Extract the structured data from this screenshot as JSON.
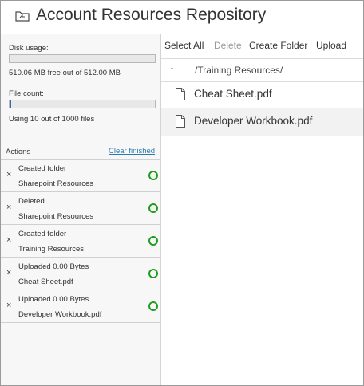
{
  "window": {
    "title": "Account Resources Repository",
    "icon": "folder-icon"
  },
  "disk": {
    "usage_label": "Disk usage:",
    "usage_text": "510.06 MB free out of 512.00 MB",
    "usage_fraction": 0.004,
    "count_label": "File count:",
    "count_text": "Using 10 out of 1000 files",
    "count_fraction": 0.01
  },
  "actions": {
    "header": "Actions",
    "clear_label": "Clear finished",
    "items": [
      {
        "line1": "Created folder",
        "line2": "Sharepoint Resources",
        "dismiss": "×"
      },
      {
        "line1": "Deleted",
        "line2": "Sharepoint Resources",
        "dismiss": "×"
      },
      {
        "line1": "Created folder",
        "line2": "Training Resources",
        "dismiss": "×"
      },
      {
        "line1": "Uploaded 0.00 Bytes",
        "line2": "Cheat Sheet.pdf",
        "dismiss": "×"
      },
      {
        "line1": "Uploaded 0.00 Bytes",
        "line2": "Developer Workbook.pdf",
        "dismiss": "×"
      }
    ]
  },
  "toolbar": {
    "select_all": "Select All",
    "delete": "Delete",
    "create_folder": "Create Folder",
    "upload": "Upload"
  },
  "browser": {
    "up_arrow": "↑",
    "path": "/Training Resources/",
    "files": [
      {
        "name": "Cheat Sheet.pdf"
      },
      {
        "name": "Developer Workbook.pdf"
      }
    ]
  },
  "colors": {
    "accent": "#3a6ea5",
    "link": "#2a7ab0",
    "success": "#1f9d1f"
  }
}
